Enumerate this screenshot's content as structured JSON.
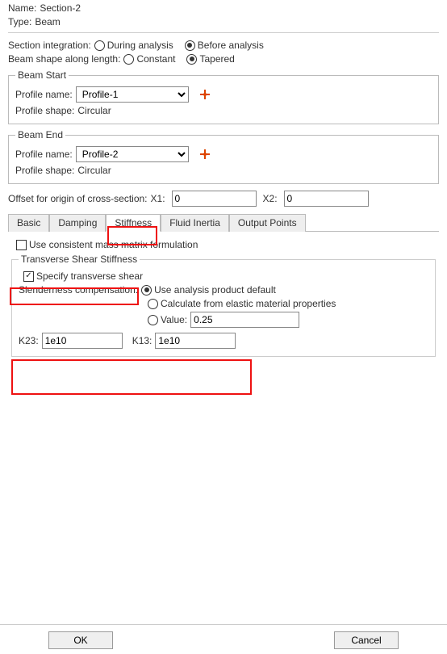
{
  "header": {
    "name_lbl": "Name:",
    "name_val": "Section-2",
    "type_lbl": "Type:",
    "type_val": "Beam"
  },
  "section_integration": {
    "label": "Section integration:",
    "opt_during": "During analysis",
    "opt_before": "Before analysis",
    "selected": "before"
  },
  "beam_shape": {
    "label": "Beam shape along length:",
    "opt_constant": "Constant",
    "opt_tapered": "Tapered",
    "selected": "tapered"
  },
  "beam_start": {
    "legend": "Beam Start",
    "profile_name_lbl": "Profile name:",
    "profile_name_val": "Profile-1",
    "profile_shape_lbl": "Profile shape:",
    "profile_shape_val": "Circular"
  },
  "beam_end": {
    "legend": "Beam End",
    "profile_name_lbl": "Profile name:",
    "profile_name_val": "Profile-2",
    "profile_shape_lbl": "Profile shape:",
    "profile_shape_val": "Circular"
  },
  "offset": {
    "label": "Offset for origin of cross-section:",
    "x1_lbl": "X1:",
    "x1_val": "0",
    "x2_lbl": "X2:",
    "x2_val": "0"
  },
  "tabs": {
    "basic": "Basic",
    "damping": "Damping",
    "stiffness": "Stiffness",
    "fluid_inertia": "Fluid Inertia",
    "output_points": "Output Points",
    "active": "stiffness"
  },
  "stiffness": {
    "use_consistent": "Use consistent mass matrix formulation",
    "use_consistent_checked": false,
    "trans_legend": "Transverse Shear Stiffness",
    "specify_trans": "Specify transverse shear",
    "specify_trans_checked": true,
    "slender_lbl": "Slenderness compensation:",
    "opt_default": "Use analysis product default",
    "opt_elastic": "Calculate from elastic material properties",
    "opt_value": "Value:",
    "opt_value_val": "0.25",
    "slender_selected": "default",
    "k23_lbl": "K23:",
    "k23_val": "1e10",
    "k13_lbl": "K13:",
    "k13_val": "1e10"
  },
  "buttons": {
    "ok": "OK",
    "cancel": "Cancel"
  }
}
